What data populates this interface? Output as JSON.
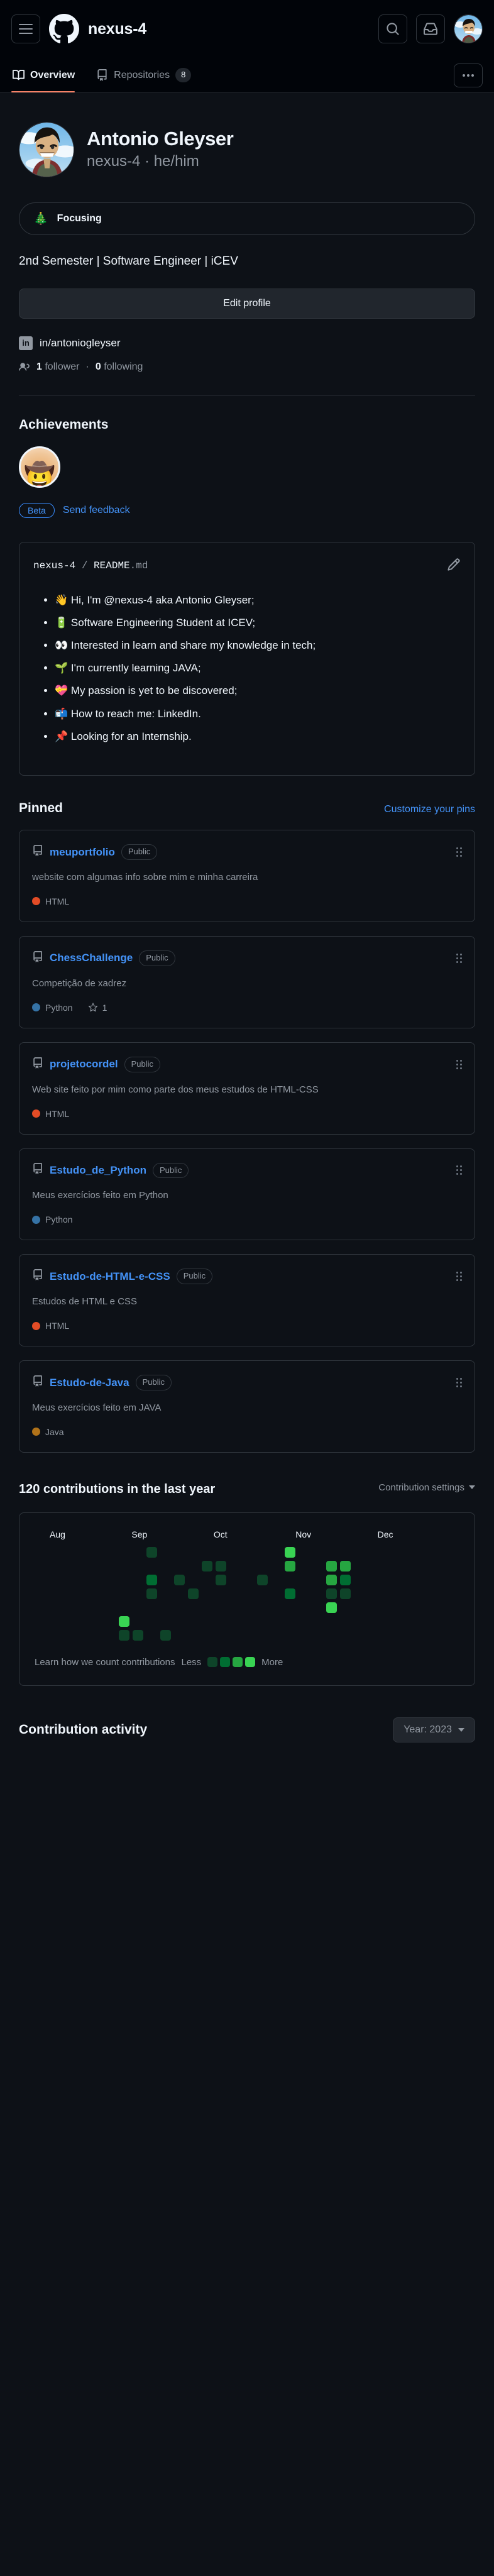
{
  "topbar": {
    "menu_icon": "hamburger-icon",
    "logo_icon": "github-mark-icon",
    "user": "nexus-4",
    "search_icon": "search-icon",
    "inbox_icon": "inbox-icon",
    "avatar_icon": "avatar"
  },
  "tabs": [
    {
      "label": "Overview",
      "icon": "book-icon",
      "active": true,
      "count": ""
    },
    {
      "label": "Repositories",
      "icon": "repo-icon",
      "active": false,
      "count": "8"
    }
  ],
  "tab_overflow_icon": "kebab-icon",
  "profile": {
    "name": "Antonio Gleyser",
    "login_line": "nexus-4 · he/him",
    "status_emoji": "🎄",
    "status_text": "Focusing",
    "bio": "2nd Semester | Software Engineer | iCEV",
    "edit_button": "Edit profile",
    "linkedin_icon": "linkedin-icon",
    "linkedin_badge": "in",
    "linkedin_text": "in/antoniogleyser",
    "people_icon": "people-icon",
    "followers_count": "1",
    "followers_label": "follower",
    "followers_sep": "·",
    "following_count": "0",
    "following_label": "following"
  },
  "achievements": {
    "title": "Achievements",
    "badge_emoji": "🤠",
    "badge_name": "quickdraw-achievement-badge",
    "beta_label": "Beta",
    "feedback_label": "Send feedback"
  },
  "readme": {
    "owner": "nexus-4",
    "separator": "/",
    "file": "README",
    "ext": ".md",
    "edit_icon": "pencil-icon",
    "bullets": [
      "👋 Hi, I'm @nexus-4 aka Antonio Gleyser;",
      "🔋 Software Engineering Student at ICEV;",
      "👀 Interested in learn and share my knowledge in tech;",
      "🌱 I'm currently learning JAVA;",
      "💝 My passion is yet to be discovered;",
      "📬 How to reach me: LinkedIn.",
      "📌 Looking for an Internship."
    ]
  },
  "pinned": {
    "title": "Pinned",
    "customize_label": "Customize your pins",
    "repos": [
      {
        "name": "meuportfolio",
        "visibility": "Public",
        "description": "website com algumas info sobre mim e minha carreira",
        "language": "HTML",
        "language_color": "#e34c26",
        "stars": ""
      },
      {
        "name": "ChessChallenge",
        "visibility": "Public",
        "description": "Competição de xadrez",
        "language": "Python",
        "language_color": "#3572A5",
        "stars": "1"
      },
      {
        "name": "projetocordel",
        "visibility": "Public",
        "description": "Web site feito por mim como parte dos meus estudos de HTML-CSS",
        "language": "HTML",
        "language_color": "#e34c26",
        "stars": ""
      },
      {
        "name": "Estudo_de_Python",
        "visibility": "Public",
        "description": "Meus exercícios feito em Python",
        "language": "Python",
        "language_color": "#3572A5",
        "stars": ""
      },
      {
        "name": "Estudo-de-HTML-e-CSS",
        "visibility": "Public",
        "description": "Estudos de HTML e CSS",
        "language": "HTML",
        "language_color": "#e34c26",
        "stars": ""
      },
      {
        "name": "Estudo-de-Java",
        "visibility": "Public",
        "description": "Meus exercícios feito em JAVA",
        "language": "Java",
        "language_color": "#b07219",
        "stars": ""
      }
    ]
  },
  "contributions": {
    "heading": "120 contributions in the last year",
    "settings_label": "Contribution settings",
    "learn_label": "Learn how we count contributions",
    "less_label": "Less",
    "more_label": "More",
    "level_colors": [
      "#161b22",
      "#0e4429",
      "#006d32",
      "#26a641",
      "#39d353"
    ]
  },
  "chart_data": {
    "type": "heatmap",
    "title": "120 contributions in the last year",
    "months": [
      "Aug",
      "Sep",
      "Oct",
      "Nov",
      "Dec"
    ],
    "legend": {
      "less": "Less",
      "more": "More",
      "levels": [
        1,
        2,
        3,
        4
      ]
    },
    "rows": 7,
    "weeks": 22,
    "cells": [
      [
        0,
        0,
        0,
        0,
        0,
        0,
        0
      ],
      [
        0,
        0,
        0,
        0,
        0,
        0,
        0
      ],
      [
        0,
        0,
        0,
        0,
        0,
        0,
        0
      ],
      [
        0,
        0,
        0,
        0,
        0,
        0,
        0
      ],
      [
        0,
        0,
        0,
        0,
        0,
        0,
        0
      ],
      [
        0,
        0,
        0,
        0,
        0,
        4,
        1
      ],
      [
        0,
        0,
        0,
        0,
        0,
        0,
        1
      ],
      [
        1,
        0,
        2,
        1,
        0,
        0,
        0
      ],
      [
        0,
        0,
        0,
        0,
        0,
        0,
        1
      ],
      [
        0,
        0,
        1,
        0,
        0,
        0,
        0
      ],
      [
        0,
        0,
        0,
        1,
        0,
        0,
        0
      ],
      [
        0,
        1,
        0,
        0,
        0,
        0,
        0
      ],
      [
        0,
        1,
        1,
        0,
        0,
        0,
        0
      ],
      [
        0,
        0,
        0,
        0,
        0,
        0,
        0
      ],
      [
        0,
        0,
        0,
        0,
        0,
        0,
        0
      ],
      [
        0,
        0,
        1,
        0,
        0,
        0,
        0
      ],
      [
        0,
        0,
        0,
        0,
        0,
        0,
        0
      ],
      [
        4,
        3,
        0,
        2,
        0,
        0,
        0
      ],
      [
        0,
        0,
        0,
        0,
        0,
        0,
        0
      ],
      [
        0,
        0,
        0,
        0,
        0,
        0,
        0
      ],
      [
        0,
        3,
        3,
        1,
        4,
        0,
        0
      ],
      [
        0,
        3,
        2,
        1,
        0,
        0,
        0
      ]
    ]
  },
  "activity": {
    "title": "Contribution activity",
    "year_label": "Year: 2023"
  }
}
